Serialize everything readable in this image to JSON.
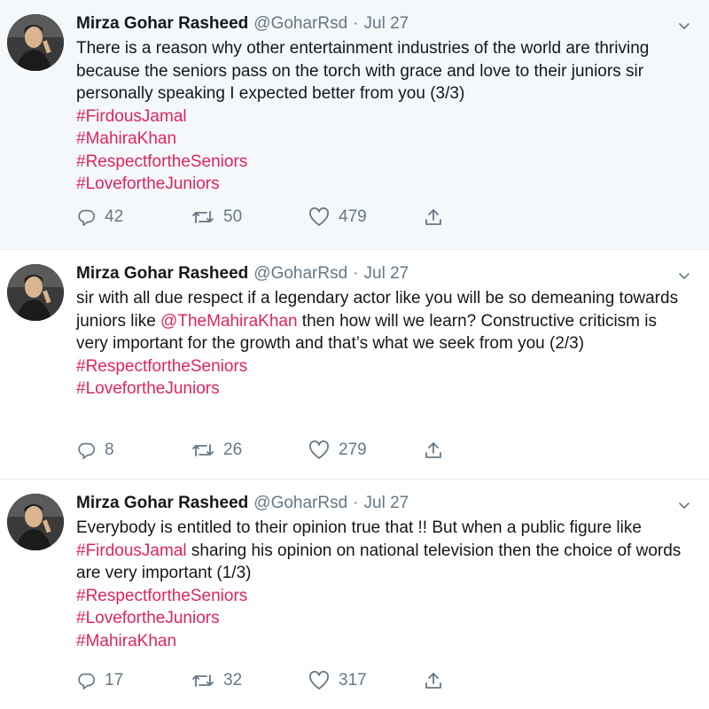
{
  "colors": {
    "text": "#14171a",
    "muted": "#657786",
    "hashtag": "#e0245e",
    "highlight_bg": "#f5f8fa",
    "divider": "#e6ecf0"
  },
  "tweets": [
    {
      "name": "Mirza Gohar Rasheed",
      "handle": "@GoharRsd",
      "dot": "·",
      "date": "Jul 27",
      "text": "There is a reason why other entertainment industries of the world are thriving because the seniors pass on the torch with grace and love to their juniors sir personally speaking I expected better from you (3/3)",
      "hashtags": [
        "#FirdousJamal",
        "#MahiraKhan",
        "#RespectfortheSeniors",
        "#LovefortheJuniors"
      ],
      "replies": "42",
      "retweets": "50",
      "likes": "479"
    },
    {
      "name": "Mirza Gohar Rasheed",
      "handle": "@GoharRsd",
      "dot": "·",
      "date": "Jul 27",
      "text_before": "sir with all due respect if a legendary actor like you will be so demeaning towards juniors like ",
      "mention": "@TheMahiraKhan",
      "text_after": " then how will we learn? Constructive criticism is very important for the growth and that’s what we seek from you (2/3)",
      "hashtags": [
        "#RespectfortheSeniors",
        "#LovefortheJuniors"
      ],
      "replies": "8",
      "retweets": "26",
      "likes": "279"
    },
    {
      "name": "Mirza Gohar Rasheed",
      "handle": "@GoharRsd",
      "dot": "·",
      "date": "Jul 27",
      "text_before": "Everybody is entitled to their opinion true that !! But when a public figure like ",
      "mention": "#FirdousJamal",
      "text_after": " sharing his opinion on national television then the choice of words are very important (1/3)",
      "hashtags": [
        "#RespectfortheSeniors",
        "#LovefortheJuniors",
        "#MahiraKhan"
      ],
      "replies": "17",
      "retweets": "32",
      "likes": "317"
    }
  ],
  "icons": {
    "reply": "reply-icon",
    "retweet": "retweet-icon",
    "like": "like-icon",
    "share": "share-icon",
    "caret": "chevron-down-icon"
  }
}
